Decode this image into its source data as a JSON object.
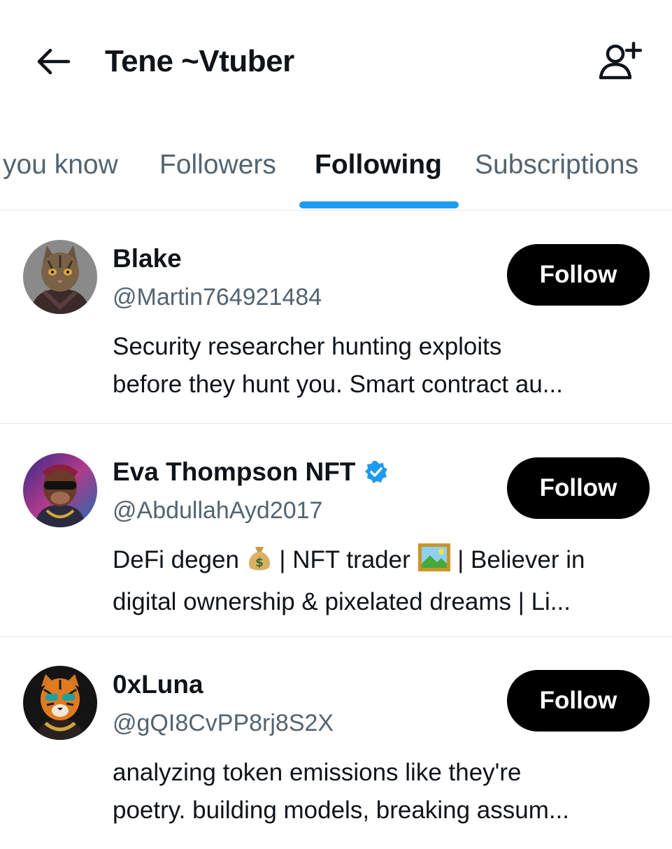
{
  "header": {
    "title": "Tene ~Vtuber",
    "back_icon": "arrow-left-icon",
    "action_icon": "add-user-icon"
  },
  "tabs": [
    {
      "label": "you know",
      "active": false
    },
    {
      "label": "Followers",
      "active": false
    },
    {
      "label": "Following",
      "active": true
    },
    {
      "label": "Subscriptions",
      "active": false
    }
  ],
  "accent_color": "#1d9bf0",
  "users": [
    {
      "name": "Blake",
      "handle": "@Martin764921484",
      "verified": false,
      "bio_line1": "Security researcher hunting exploits",
      "bio_line2": "before they hunt you. Smart contract au...",
      "follow_label": "Follow"
    },
    {
      "name": "Eva Thompson NFT",
      "handle": "@AbdullahAyd2017",
      "verified": true,
      "bio_line1_a": "DeFi degen ",
      "bio_line1_b": " | NFT trader ",
      "bio_line1_c": " | Believer in",
      "bio_line2": "digital ownership & pixelated dreams | Li...",
      "follow_label": "Follow"
    },
    {
      "name": "0xLuna",
      "handle": "@gQI8CvPP8rj8S2X",
      "verified": false,
      "bio_line1": "analyzing token emissions like they're",
      "bio_line2": "poetry. building models, breaking assum...",
      "follow_label": "Follow"
    }
  ]
}
